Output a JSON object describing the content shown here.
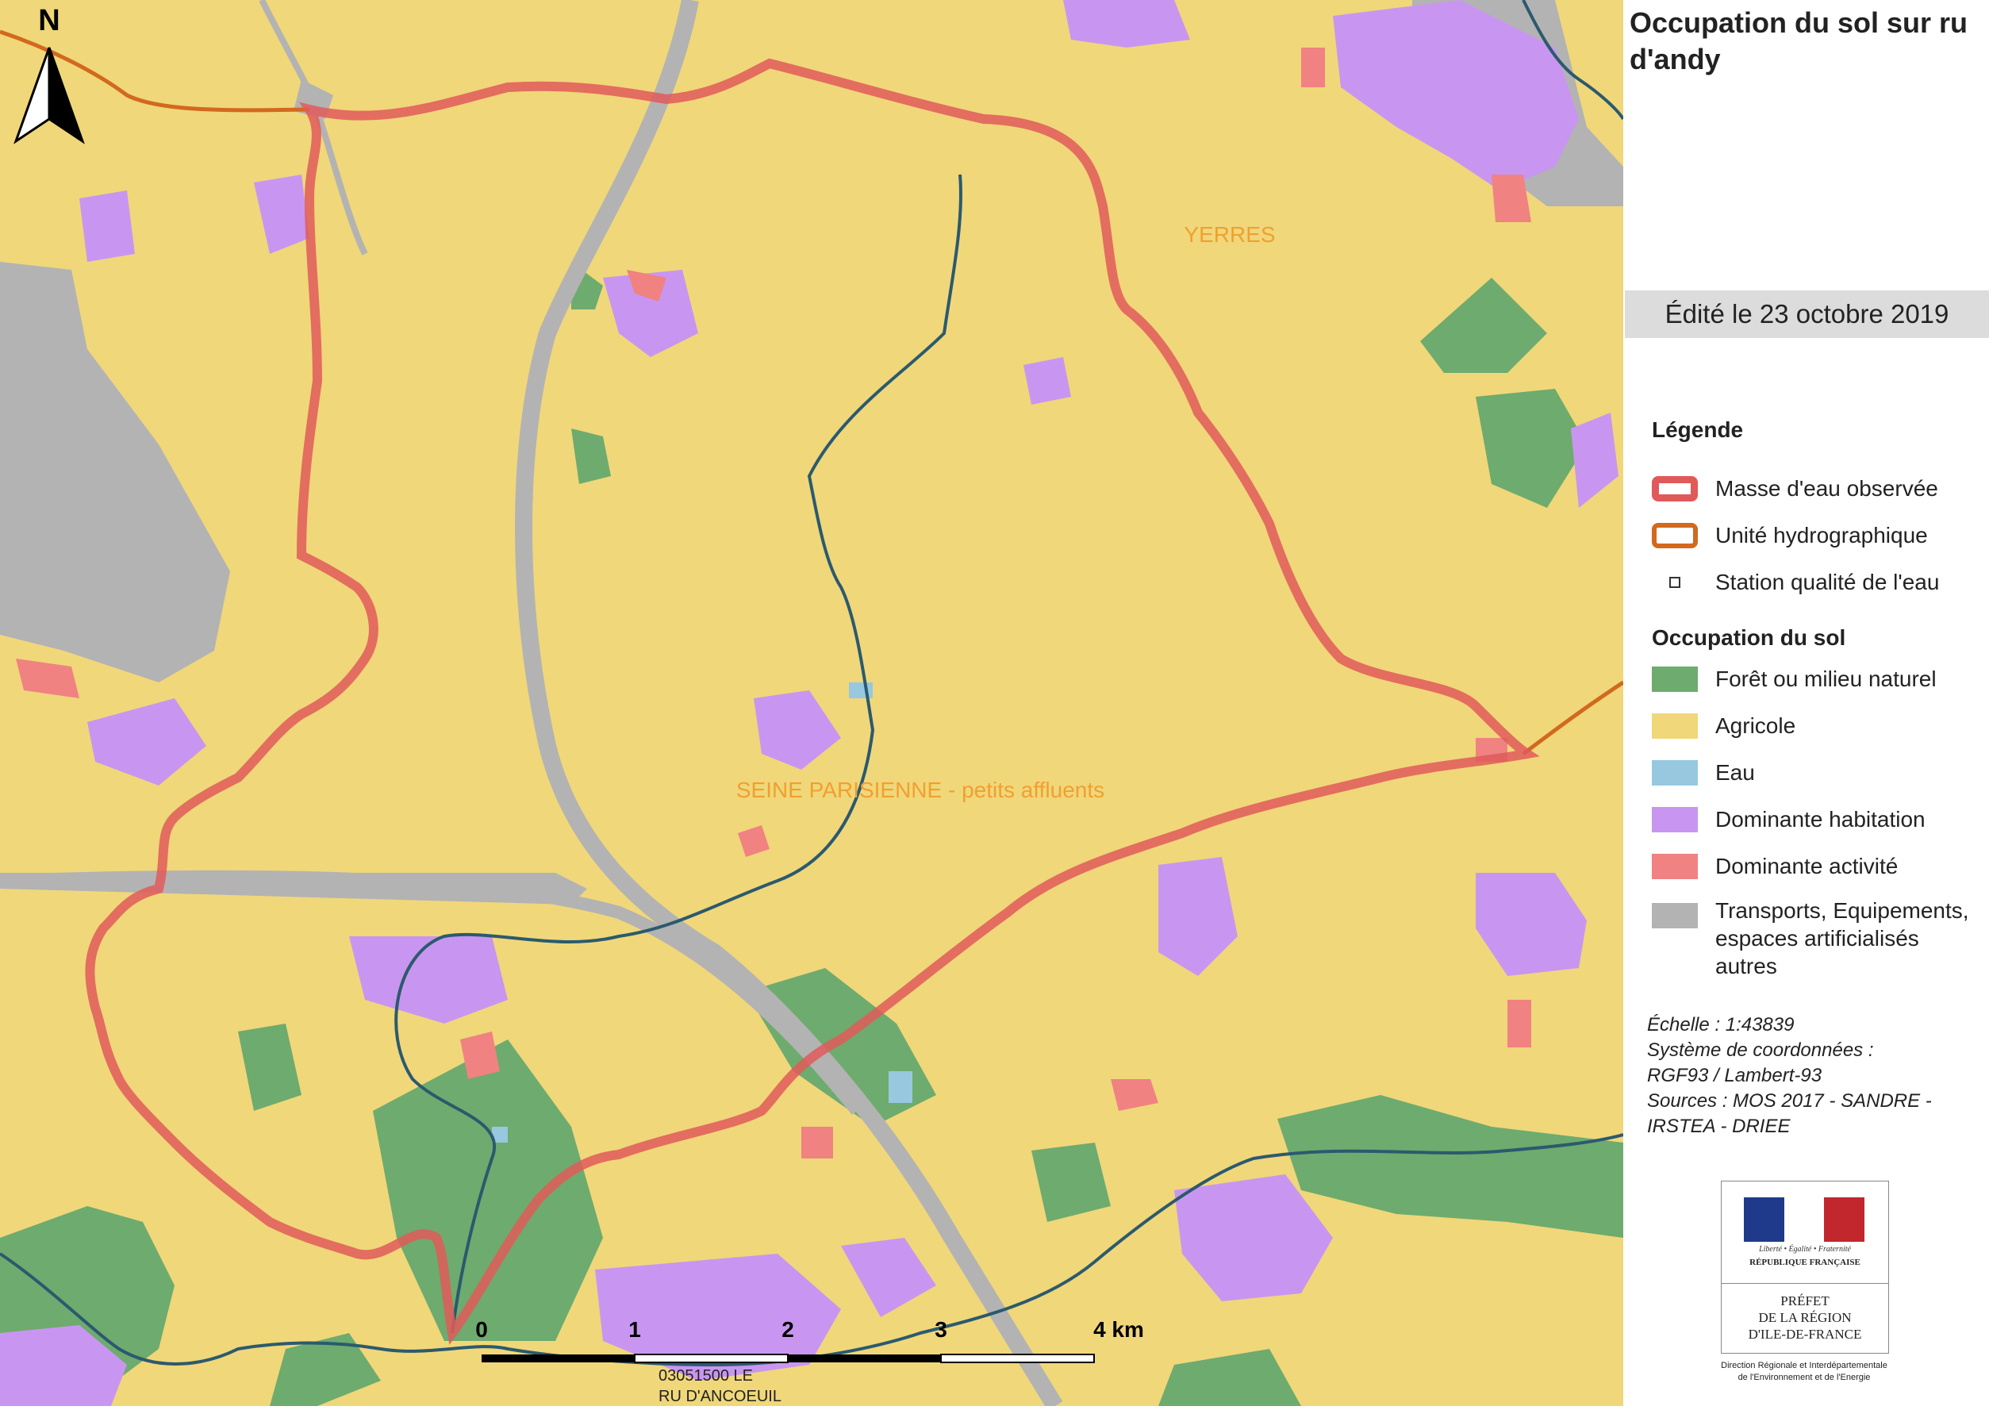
{
  "title": "Occupation du sol sur ru d'andy",
  "edition": "Édité le 23 octobre 2019",
  "legend": {
    "heading": "Légende",
    "items": [
      {
        "label": "Masse d'eau observée",
        "color": "#e05a5a",
        "symbol": "thick-outline"
      },
      {
        "label": "Unité hydrographique",
        "color": "#d2691e",
        "symbol": "outline"
      },
      {
        "label": "Station qualité de l'eau",
        "color": "#333333",
        "symbol": "square"
      }
    ],
    "landuse_heading": "Occupation du sol",
    "landuse": [
      {
        "label": "Forêt ou milieu naturel",
        "color": "#6eab6e"
      },
      {
        "label": "Agricole",
        "color": "#f0d77a"
      },
      {
        "label": "Eau",
        "color": "#97c8e0"
      },
      {
        "label": "Dominante habitation",
        "color": "#c896f0"
      },
      {
        "label": "Dominante activité",
        "color": "#f08282"
      },
      {
        "label": "Transports, Equipements,\nespaces artificialisés\n autres",
        "color": "#b3b3b3"
      }
    ]
  },
  "metadata": {
    "scale": "Échelle :  1:43839",
    "crs_label": "Système de coordonnées :",
    "crs_value": "RGF93 / Lambert-93",
    "sources_1": "Sources : MOS 2017 - SANDRE -",
    "sources_2": "IRSTEA - DRIEE"
  },
  "map": {
    "north": "N",
    "labels": {
      "yerres": "YERRES",
      "seine": "SEINE PARISIENNE - petits affluents",
      "station_1": "03051500   LE",
      "station_2": "RU D'ANCOEUIL"
    },
    "scalebar": {
      "ticks": [
        "0",
        "1",
        "2",
        "3",
        "4  km"
      ]
    },
    "colors": {
      "agricole": "#f0d77a",
      "foret": "#6eab6e",
      "habitation": "#c896f0",
      "activite": "#f08282",
      "transport": "#b3b3b3",
      "eau": "#97c8e0",
      "river": "#2b5a6e",
      "masse_eau": "#e05a5a",
      "unite": "#d2691e",
      "label_orange": "#f0a030"
    }
  },
  "logo": {
    "motto": "Liberté • Égalité • Fraternité",
    "republique": "RÉPUBLIQUE FRANÇAISE",
    "prefet": "PRÉFET\nDE LA RÉGION\nD'ILE-DE-FRANCE",
    "direction": "Direction Régionale et Interdépartementale\nde l'Environnement et de l'Energie"
  }
}
